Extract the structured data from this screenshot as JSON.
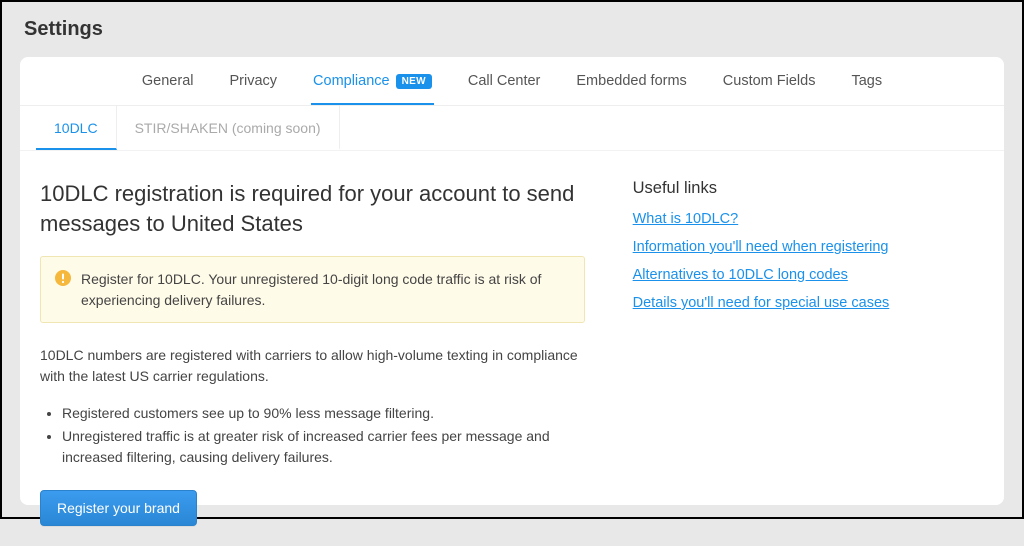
{
  "page_title": "Settings",
  "tabs_primary": [
    {
      "label": "General",
      "active": false
    },
    {
      "label": "Privacy",
      "active": false
    },
    {
      "label": "Compliance",
      "active": true,
      "badge": "NEW"
    },
    {
      "label": "Call Center",
      "active": false
    },
    {
      "label": "Embedded forms",
      "active": false
    },
    {
      "label": "Custom Fields",
      "active": false
    },
    {
      "label": "Tags",
      "active": false
    }
  ],
  "tabs_secondary": [
    {
      "label": "10DLC",
      "active": true
    },
    {
      "label": "STIR/SHAKEN (coming soon)",
      "active": false
    }
  ],
  "main": {
    "heading": "10DLC registration is required for your account to send messages to United States",
    "alert": "Register for 10DLC. Your unregistered 10-digit long code traffic is at risk of experiencing delivery failures.",
    "body": "10DLC numbers are registered with carriers to allow high-volume texting in compliance with the latest US carrier regulations.",
    "bullets": [
      "Registered customers see up to 90% less message filtering.",
      "Unregistered traffic is at greater risk of increased carrier fees per message and increased filtering, causing delivery failures."
    ],
    "cta": "Register your brand"
  },
  "sidebar": {
    "heading": "Useful links",
    "links": [
      "What is 10DLC?",
      "Information you'll need when registering",
      "Alternatives to 10DLC long codes",
      "Details you'll need for special use cases"
    ]
  }
}
